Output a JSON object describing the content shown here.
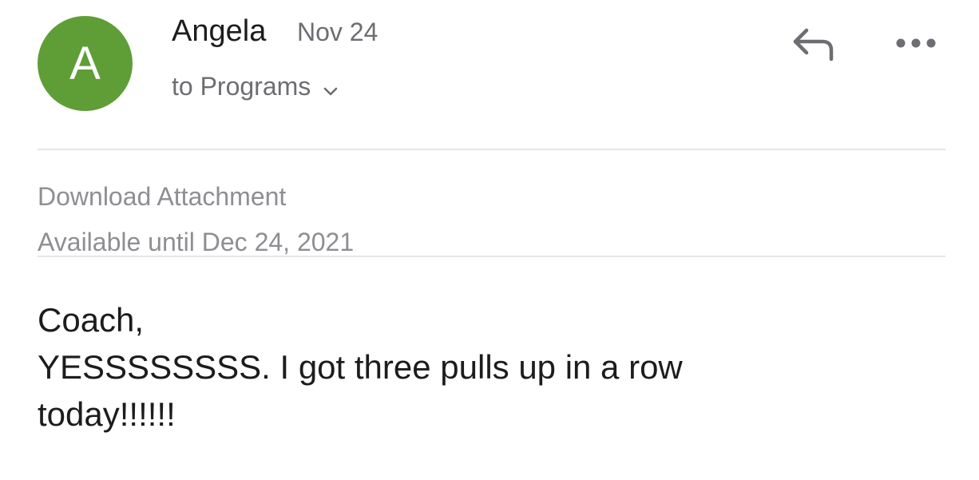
{
  "email": {
    "sender": {
      "name": "Angela",
      "avatar_initial": "A",
      "avatar_color": "#5f9e37"
    },
    "date": "Nov 24",
    "recipient_text": "to Programs",
    "actions": {
      "reply_icon": "reply-arrow-icon",
      "more_icon": "ellipsis-icon",
      "recipient_toggle_icon": "chevron-down-icon"
    },
    "attachment": {
      "label": "Download Attachment",
      "availability": "Available until Dec 24, 2021"
    },
    "body": {
      "lines": [
        "Coach,",
        "YESSSSSSSS. I got three pulls up in a row",
        "today!!!!!!"
      ]
    }
  }
}
